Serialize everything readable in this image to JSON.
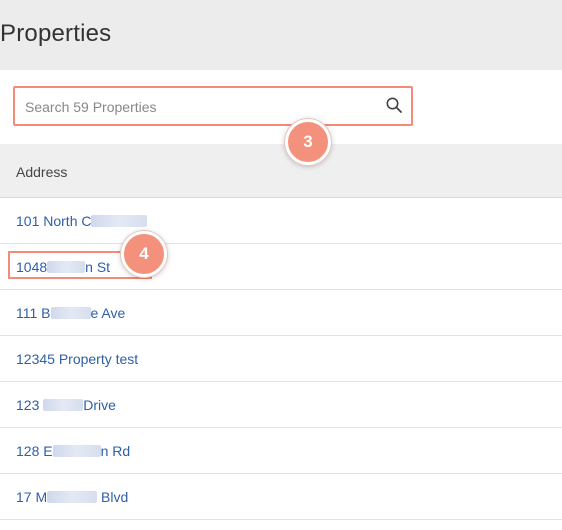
{
  "page": {
    "title": "Properties"
  },
  "search": {
    "placeholder": "Search 59 Properties",
    "value": ""
  },
  "callouts": {
    "step_3": "3",
    "step_4": "4"
  },
  "table": {
    "header": "Address",
    "rows": [
      {
        "prefix": "101 North C",
        "suffix": ""
      },
      {
        "prefix": "1048",
        "suffix": "n St"
      },
      {
        "prefix": "111 B",
        "suffix": "e Ave"
      },
      {
        "prefix": "12345 Property test",
        "suffix": ""
      },
      {
        "prefix": "123 ",
        "suffix": "Drive"
      },
      {
        "prefix": "128 E",
        "suffix": "n Rd"
      },
      {
        "prefix": "17 M",
        "suffix": " Blvd"
      }
    ]
  },
  "colors": {
    "annotation": "#f28b78",
    "link": "#2f5fa8",
    "header_bg": "#efefef",
    "page_bg": "#ececec"
  }
}
